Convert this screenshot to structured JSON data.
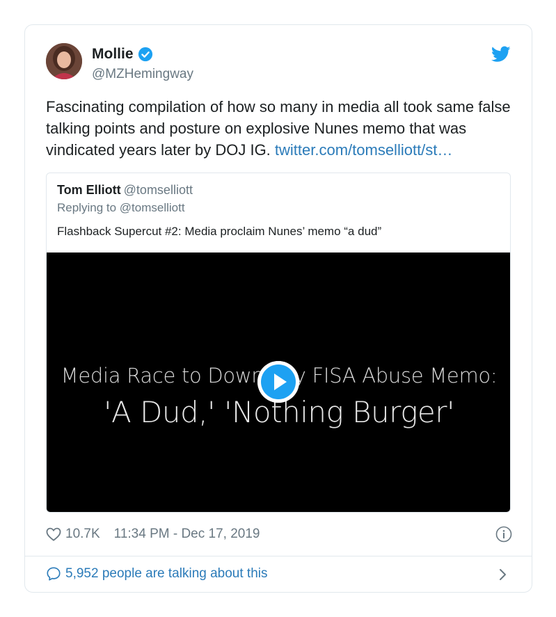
{
  "author": {
    "name": "Mollie",
    "handle": "@MZHemingway"
  },
  "tweet": {
    "text": "Fascinating compilation of how so many in media all took same false talking points and posture on explosive Nunes memo that was vindicated years later by DOJ IG. ",
    "link": "twitter.com/tomselliott/st…"
  },
  "quoted": {
    "name": "Tom Elliott",
    "handle": "@tomselliott",
    "reply": "Replying to @tomselliott",
    "text": "Flashback Supercut #2: Media proclaim Nunes’ memo “a dud”",
    "video": {
      "line1": "Media Race to Downplay FISA Abuse Memo:",
      "line2": "'A Dud,' 'Nothing Burger'"
    }
  },
  "meta": {
    "likes": "10.7K",
    "timestamp": "11:34 PM - Dec 17, 2019"
  },
  "footer": {
    "talking": "5,952 people are talking about this"
  },
  "colors": {
    "accent": "#1da1f2",
    "link": "#2b7bb9",
    "muted": "#697882"
  },
  "icons": [
    "verified-icon",
    "twitter-bird-icon",
    "play-icon",
    "heart-icon",
    "info-icon",
    "comment-bubble-icon",
    "chevron-right-icon"
  ]
}
